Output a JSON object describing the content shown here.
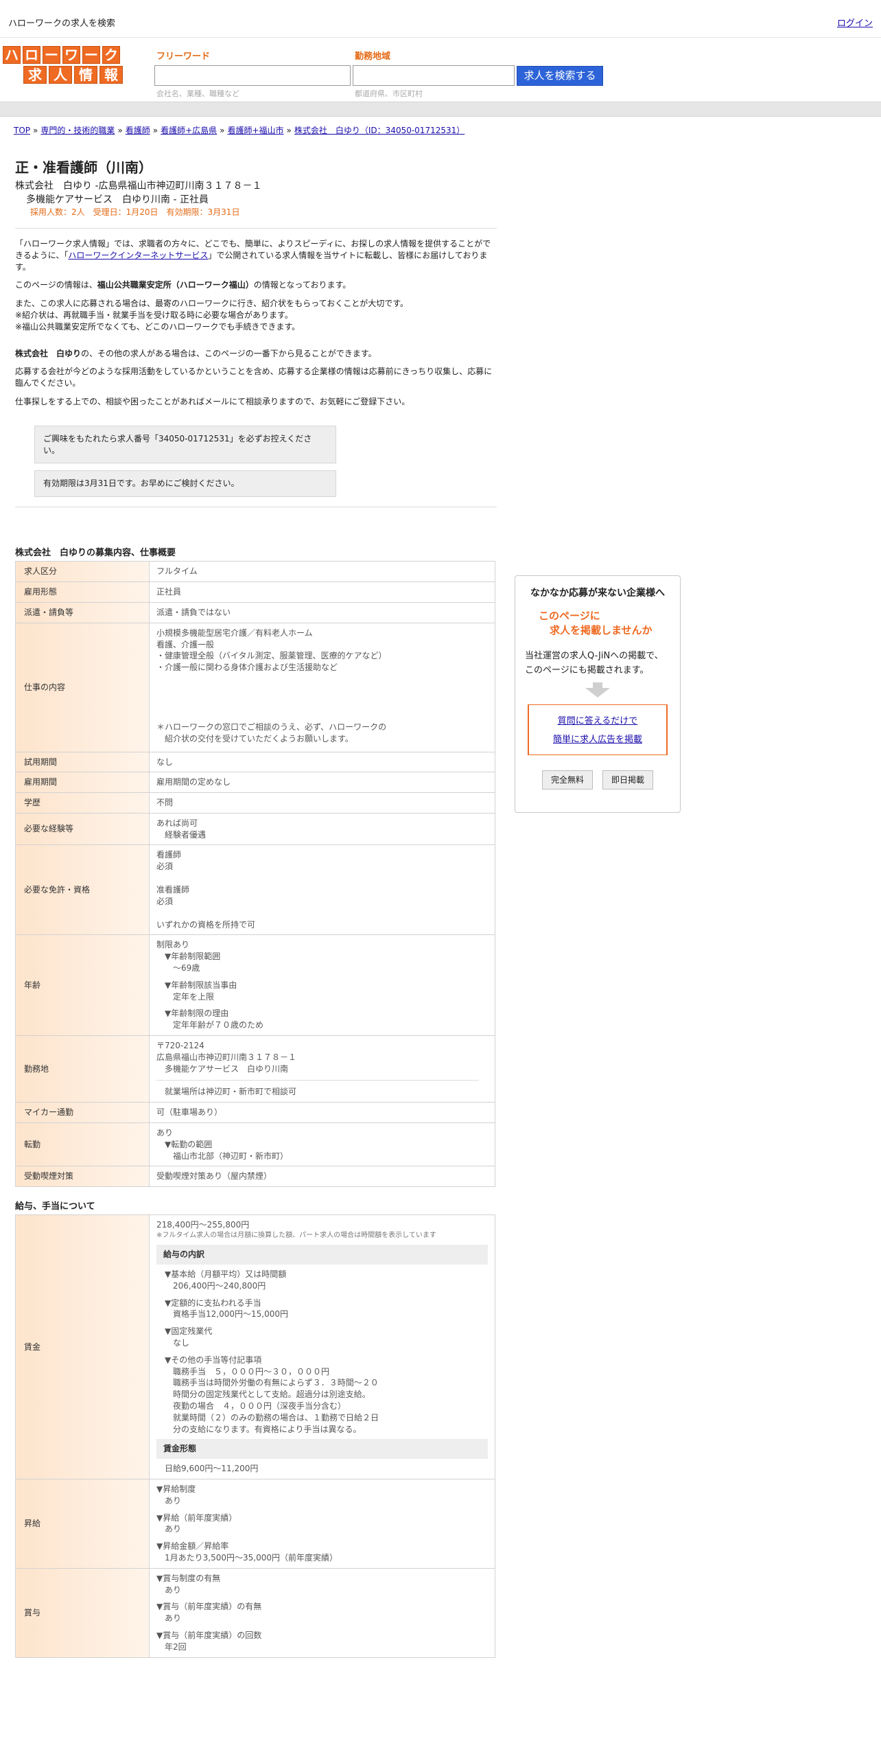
{
  "header": {
    "site_title": "ハローワークの求人を検索",
    "login": "ログイン"
  },
  "logo": {
    "row1": [
      "ハ",
      "ロ",
      "ー",
      "ワ",
      "ー",
      "ク"
    ],
    "row2": [
      "求",
      "人",
      "情",
      "報"
    ]
  },
  "search": {
    "keyword_label": "フリーワード",
    "keyword_hint": "会社名、業種、職種など",
    "area_label": "勤務地域",
    "area_hint": "都道府県、市区町村",
    "button": "求人を検索する"
  },
  "breadcrumb": [
    {
      "label": "TOP"
    },
    {
      "label": "専門的・技術的職業"
    },
    {
      "label": "看護師"
    },
    {
      "label": "看護師+広島県"
    },
    {
      "label": "看護師+福山市"
    },
    {
      "label": "株式会社　白ゆり（ID：34050-01712531）"
    }
  ],
  "breadcrumb_sep": "»",
  "job": {
    "title": "正・准看護師（川南）",
    "company_line": "株式会社　白ゆり -広島県福山市神辺町川南３１７８－１",
    "facility_line": "多機能ケアサービス　白ゆり川南 - 正社員",
    "meta_line": "採用人数：2人　受理日：1月20日　有効期限：3月31日"
  },
  "intro": {
    "p1_a": "「ハローワーク求人情報」では、求職者の方々に、どこでも、簡単に、よりスピーディに、お探しの求人情報を提供することができるように、「",
    "p1_link": "ハローワークインターネットサービス",
    "p1_b": "」で公開されている求人情報を当サイトに転載し、皆様にお届けしております。",
    "p2_a": "このページの情報は、",
    "p2_bold": "福山公共職業安定所（ハローワーク福山）",
    "p2_b": "の情報となっております。",
    "p3_line1": "また、この求人に応募される場合は、最寄のハローワークに行き、紹介状をもらっておくことが大切です。",
    "p3_line2": "※紹介状は、再就職手当・就業手当を受け取る時に必要な場合があります。",
    "p3_line3": "※福山公共職業安定所でなくても、どこのハローワークでも手続きできます。",
    "p4_bold": "株式会社　白ゆり",
    "p4_rest": "の、その他の求人がある場合は、このページの一番下から見ることができます。",
    "p5": "応募する会社が今どのような採用活動をしているかということを含め、応募する企業様の情報は応募前にきっちり収集し、応募に臨んでください。",
    "p6": "仕事探しをする上での、相談や困ったことがあればメールにて相談承りますので、お気軽にご登録下さい。",
    "note1": "ご興味をもたれたら求人番号「34050-01712531」を必ずお控えください。",
    "note2": "有効期限は3月31日です。お早めにご検討ください。"
  },
  "overview": {
    "title": "株式会社　白ゆりの募集内容、仕事概要",
    "kubun": {
      "label": "求人区分",
      "value": "フルタイム"
    },
    "koyo": {
      "label": "雇用形態",
      "value": "正社員"
    },
    "haken": {
      "label": "派遣・請負等",
      "value": "派遣・請負ではない"
    },
    "shigoto": {
      "label": "仕事の内容",
      "l1": "小規模多機能型居宅介護／有料老人ホーム",
      "l2": "看護、介護一般",
      "l3": "・健康管理全般（バイタル測定、服薬管理、医療的ケアなど）",
      "l4": "・介護一般に関わる身体介護および生活援助など",
      "n1": "＊ハローワークの窓口でご相談のうえ、必ず、ハローワークの",
      "n2": "紹介状の交付を受けていただくようお願いします。"
    },
    "shiyo": {
      "label": "試用期間",
      "value": "なし"
    },
    "kikan": {
      "label": "雇用期間",
      "value": "雇用期間の定めなし"
    },
    "gakureki": {
      "label": "学歴",
      "value": "不問"
    },
    "keiken": {
      "label": "必要な経験等",
      "v1": "あれば尚可",
      "v2": "経験者優遇"
    },
    "menkyo": {
      "label": "必要な免許・資格",
      "v1": "看護師",
      "v2": "必須",
      "v3": "准看護師",
      "v4": "必須",
      "v5": "いずれかの資格を所持で可"
    },
    "nenrei": {
      "label": "年齢",
      "v1": "制限あり",
      "h1": "▼年齢制限範囲",
      "d1": "〜69歳",
      "h2": "▼年齢制限該当事由",
      "d2": "定年を上限",
      "h3": "▼年齢制限の理由",
      "d3": "定年年齢が７０歳のため"
    },
    "kinmuchi": {
      "label": "勤務地",
      "v1": "〒720-2124",
      "v2": "広島県福山市神辺町川南３１７８－１",
      "v3": "多機能ケアサービス　白ゆり川南",
      "v4": "就業場所は神辺町・新市町で相談可"
    },
    "mycar": {
      "label": "マイカー通勤",
      "value": "可（駐車場あり）"
    },
    "tenkin": {
      "label": "転勤",
      "v1": "あり",
      "h1": "▼転勤の範囲",
      "d1": "福山市北部（神辺町・新市町）"
    },
    "kitsuen": {
      "label": "受動喫煙対策",
      "value": "受動喫煙対策あり（屋内禁煙）"
    }
  },
  "salary": {
    "title": "給与、手当について",
    "chingin": {
      "label": "賃金",
      "range": "218,400円〜255,800円",
      "note": "※フルタイム求人の場合は月額に換算した額、パート求人の場合は時間額を表示しています",
      "breakdown_head": "給与の内訳",
      "h1": "▼基本給（月額平均）又は時間額",
      "d1": "206,400円〜240,800円",
      "h2": "▼定額的に支払われる手当",
      "d2": "資格手当12,000円〜15,000円",
      "h3": "▼固定残業代",
      "d3": "なし",
      "h4": "▼その他の手当等付記事項",
      "o1": "職務手当　５，０００円～３０，０００円",
      "o2": "職務手当は時間外労働の有無によらず３．３時間～２０",
      "o3": "時間分の固定残業代として支給。超過分は別途支給。",
      "o4": "夜勤の場合　４，０００円（深夜手当分含む）",
      "o5": "就業時間（２）のみの勤務の場合は、１勤務で日給２日",
      "o6": "分の支給になります。有資格により手当は異なる。",
      "form_head": "賃金形態",
      "form_value": "日給9,600円〜11,200円"
    },
    "shokyu": {
      "label": "昇給",
      "h1": "▼昇給制度",
      "d1": "あり",
      "h2": "▼昇給（前年度実績）",
      "d2": "あり",
      "h3": "▼昇給金額／昇給率",
      "d3": "1月あたり3,500円〜35,000円（前年度実績）"
    },
    "shoyo": {
      "label": "賞与",
      "h1": "▼賞与制度の有無",
      "d1": "あり",
      "h2": "▼賞与（前年度実績）の有無",
      "d2": "あり",
      "h3": "▼賞与（前年度実績）の回数",
      "d3": "年2回"
    }
  },
  "ad": {
    "title": "なかなか応募が来ない企業様へ",
    "catch1": "このページに",
    "catch2": "求人を掲載しませんか",
    "text1": "当社運営の求人Q-JiNへの掲載で、",
    "text2": "このページにも掲載されます。",
    "link1": "質問に答えるだけで",
    "link2": "簡単に求人広告を掲載",
    "btn1": "完全無料",
    "btn2": "即日掲載"
  }
}
